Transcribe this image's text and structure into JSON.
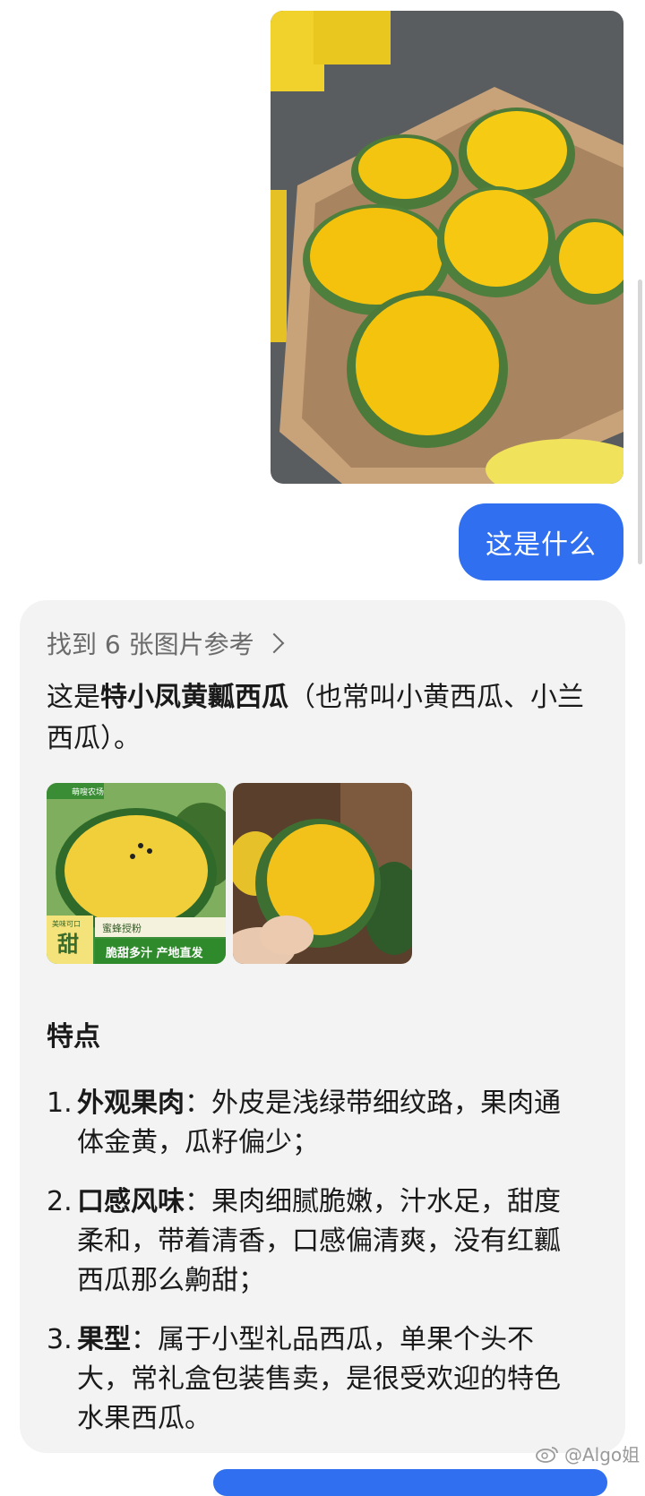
{
  "user_message": {
    "photo_icon": "photo-yellow-watermelons",
    "text": "这是什么"
  },
  "answer": {
    "refs_link": "找到 6 张图片参考",
    "intro_prefix": "这是",
    "intro_bold": "特小凤黄瓤西瓜",
    "intro_suffix": "（也常叫小黄西瓜、小兰西瓜）。",
    "thumbs": [
      {
        "brand": "萌嗖农场",
        "badge_top": "美味可口",
        "badge_main": "甜",
        "tag": "蜜蜂授粉",
        "slogan": "脆甜多汁 产地直发"
      },
      {
        "icon": "photo-hand-holding-watermelon"
      }
    ],
    "section_title": "特点",
    "features": [
      {
        "num": "1.",
        "name": "外观果肉",
        "text": "：外皮是浅绿带细纹路，果肉通体金黄，瓜籽偏少；"
      },
      {
        "num": "2.",
        "name": "口感风味",
        "text": "：果肉细腻脆嫩，汁水足，甜度柔和，带着清香，口感偏清爽，没有红瓤西瓜那么齁甜；"
      },
      {
        "num": "3.",
        "name": "果型",
        "text": "：属于小型礼品西瓜，单果个头不大，常礼盒包装售卖，是很受欢迎的特色水果西瓜。"
      }
    ]
  },
  "watermark": "@Algo姐",
  "colors": {
    "accent": "#2f6ff0",
    "card_bg": "#f3f3f3",
    "flesh_yellow": "#f2c40d"
  }
}
